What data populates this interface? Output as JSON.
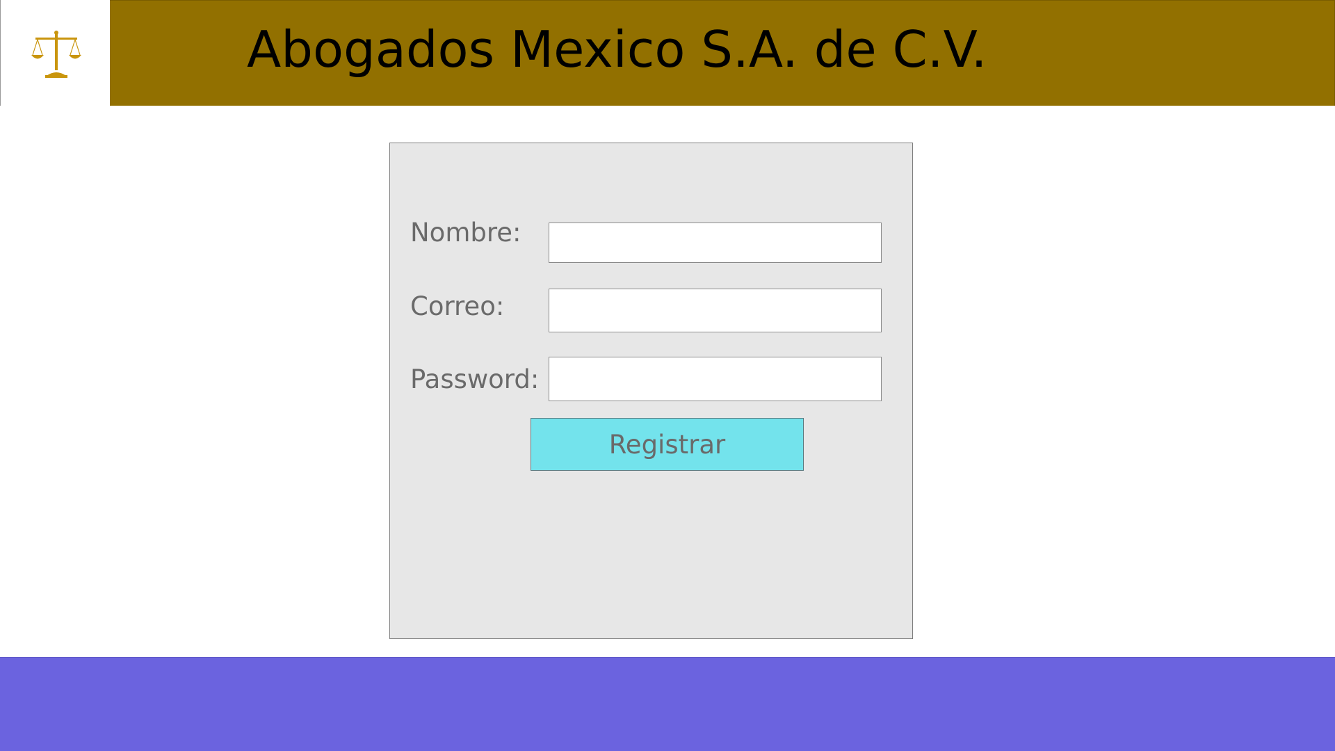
{
  "header": {
    "logo_icon": "scales-of-justice-icon",
    "title": "Abogados Mexico S.A. de C.V."
  },
  "form": {
    "nombre_label": "Nombre:",
    "nombre_value": "",
    "correo_label": "Correo:",
    "correo_value": "",
    "password_label": "Password:",
    "password_value": "",
    "submit_label": "Registrar"
  },
  "colors": {
    "header_bg": "#927000",
    "logo_gold": "#c9950d",
    "panel_bg": "#e7e7e7",
    "button_bg": "#73e3ec",
    "footer_bg": "#6b63df",
    "label_text": "#6a6a6a"
  }
}
